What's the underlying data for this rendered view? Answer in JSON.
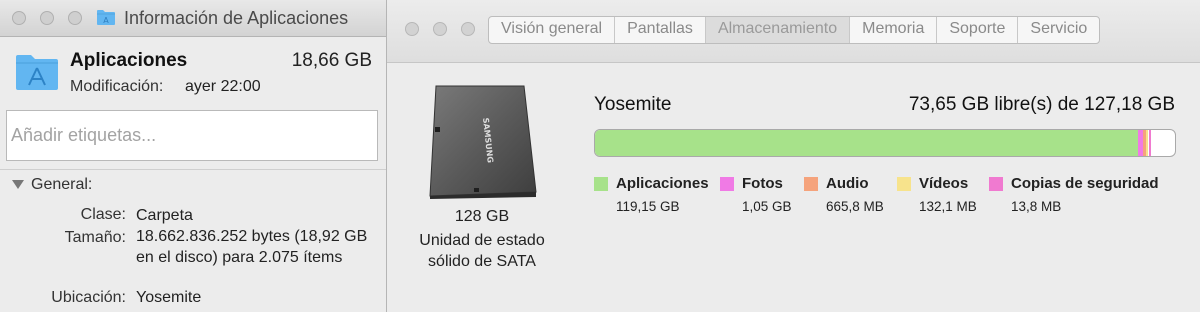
{
  "info_window": {
    "title": "Información de Aplicaciones",
    "item_name": "Aplicaciones",
    "item_size": "18,66 GB",
    "modified_label": "Modificación:",
    "modified_value": "ayer 22:00",
    "tags_placeholder": "Añadir etiquetas...",
    "general_section": "General:",
    "rows": [
      {
        "label": "Clase:",
        "value": "Carpeta"
      },
      {
        "label": "Tamaño:",
        "value": "18.662.836.252 bytes (18,92 GB en el disco) para 2.075 ítems"
      },
      {
        "label": "Ubicación:",
        "value": "Yosemite"
      }
    ],
    "folder_icon_color": "#62b6f1"
  },
  "mac_window": {
    "tabs": [
      {
        "label": "Visión general",
        "active": false
      },
      {
        "label": "Pantallas",
        "active": false
      },
      {
        "label": "Almacenamiento",
        "active": true
      },
      {
        "label": "Memoria",
        "active": false
      },
      {
        "label": "Soporte",
        "active": false
      },
      {
        "label": "Servicio",
        "active": false
      }
    ],
    "disk": {
      "icon": "ssd-drive-icon",
      "capacity": "128 GB",
      "type_line1": "Unidad de estado",
      "type_line2": "sólido de SATA",
      "brand_text": "SAMSUNG"
    },
    "volume": {
      "name": "Yosemite",
      "free_text": "73,65 GB libre(s) de 127,18 GB"
    },
    "storage": {
      "total_gb": 127.18,
      "categories": [
        {
          "name": "Aplicaciones",
          "size": "119,15 GB",
          "gb": 119.15,
          "color": "#a7e28a"
        },
        {
          "name": "Fotos",
          "size": "1,05 GB",
          "gb": 1.05,
          "color": "#f07ae5"
        },
        {
          "name": "Audio",
          "size": "665,8 MB",
          "gb": 0.6658,
          "color": "#f5a37c"
        },
        {
          "name": "Vídeos",
          "size": "132,1 MB",
          "gb": 0.1321,
          "color": "#f7e38c"
        },
        {
          "name": "Copias de seguridad",
          "size": "13,8 MB",
          "gb": 0.0138,
          "color": "#f07ad0"
        }
      ]
    }
  }
}
